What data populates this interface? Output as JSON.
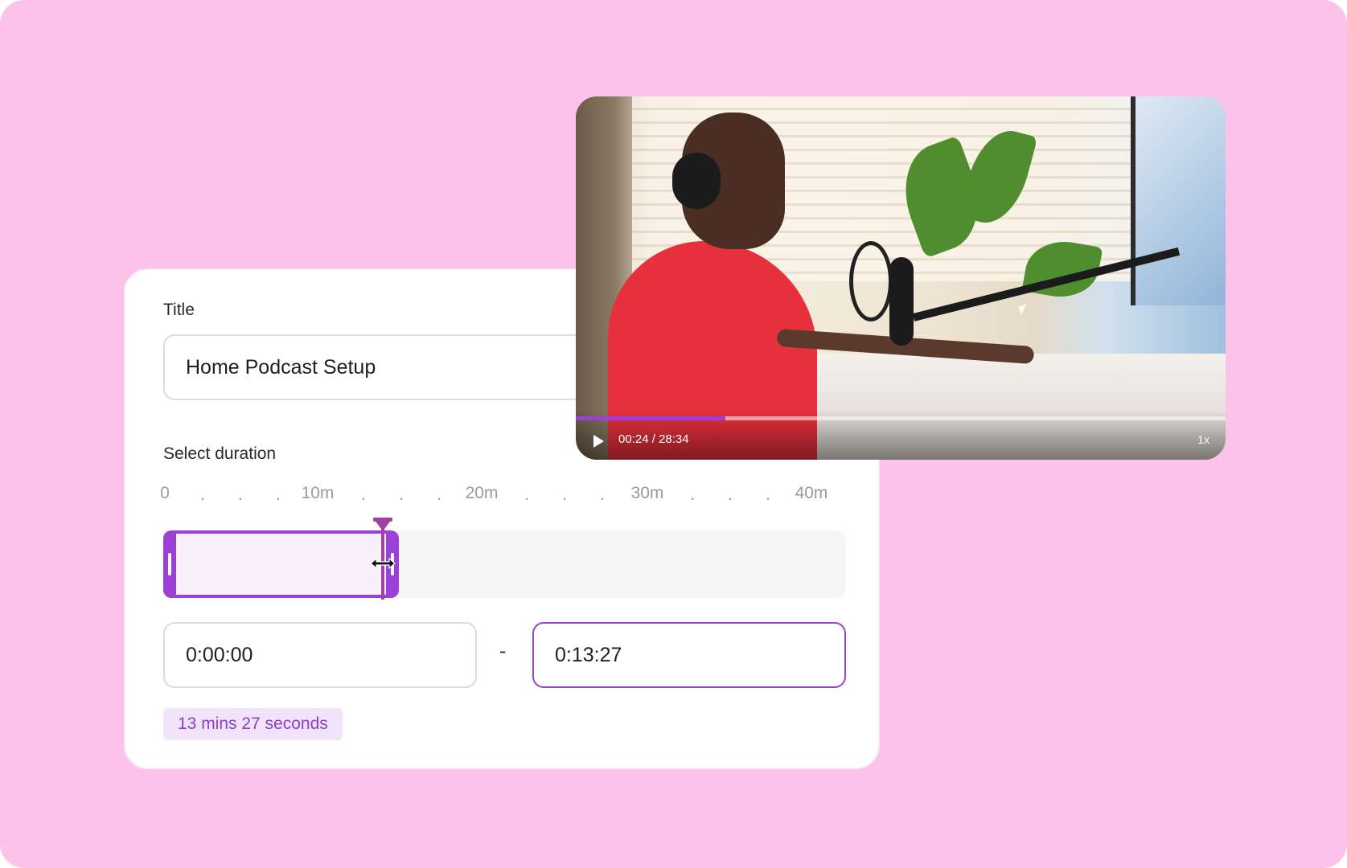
{
  "form": {
    "title_label": "Title",
    "title_value": "Home Podcast Setup",
    "duration_label": "Select duration",
    "ticks": [
      "0",
      "10m",
      "20m",
      "30m",
      "40m"
    ],
    "range_separator": "-",
    "start_time": "0:00:00",
    "end_time": "0:13:27",
    "duration_badge": "13 mins 27 seconds",
    "selection_fraction": 0.336,
    "accent": "#9b3fd6"
  },
  "video": {
    "time_display": "00:24 / 28:34",
    "speed": "1x",
    "progress_fraction": 0.23
  },
  "colors": {
    "background": "#fdc2ea",
    "card": "#ffffff",
    "accent": "#9b3fd6",
    "badge_bg": "#f1e3fa",
    "badge_text": "#8b3fc8",
    "playhead": "#a53fa6"
  }
}
